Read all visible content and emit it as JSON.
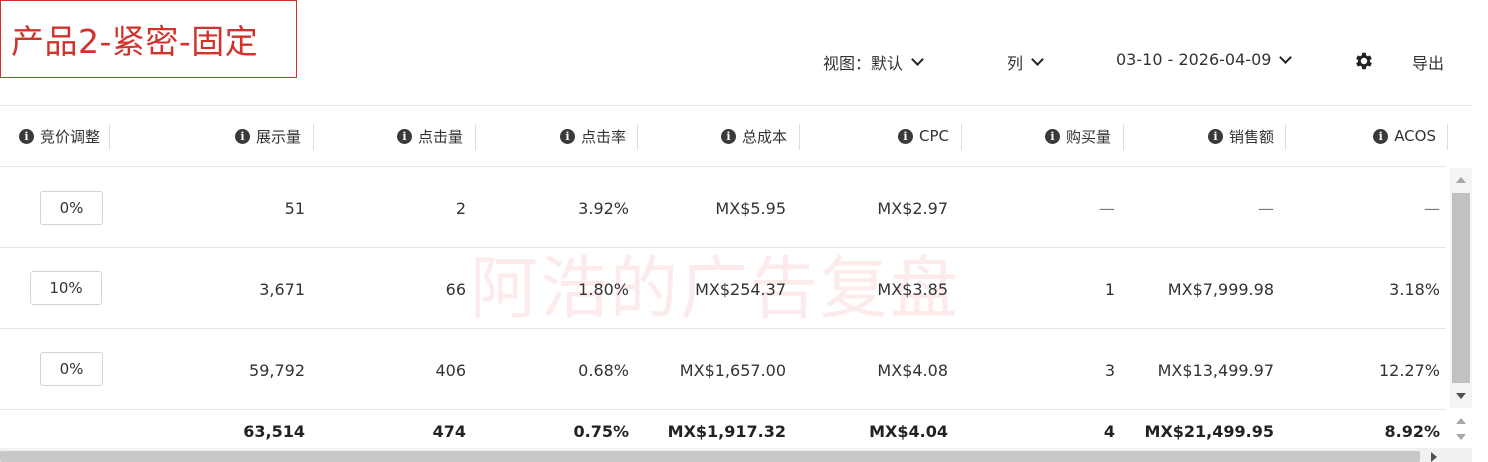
{
  "title": "产品2-紧密-固定",
  "toolbar": {
    "view_label": "视图：默认",
    "columns_label": "列",
    "date_range": "03-10 - 2026-04-09",
    "export_label": "导出"
  },
  "columns": [
    "竞价调整",
    "展示量",
    "点击量",
    "点击率",
    "总成本",
    "CPC",
    "购买量",
    "销售额",
    "ACOS"
  ],
  "rows": [
    {
      "bid_adjust": "0%",
      "impressions": "51",
      "clicks": "2",
      "ctr": "3.92%",
      "cost": "MX$5.95",
      "cpc": "MX$2.97",
      "purchases": "—",
      "sales": "—",
      "acos": "—"
    },
    {
      "bid_adjust": "10%",
      "impressions": "3,671",
      "clicks": "66",
      "ctr": "1.80%",
      "cost": "MX$254.37",
      "cpc": "MX$3.85",
      "purchases": "1",
      "sales": "MX$7,999.98",
      "acos": "3.18%"
    },
    {
      "bid_adjust": "0%",
      "impressions": "59,792",
      "clicks": "406",
      "ctr": "0.68%",
      "cost": "MX$1,657.00",
      "cpc": "MX$4.08",
      "purchases": "3",
      "sales": "MX$13,499.97",
      "acos": "12.27%"
    }
  ],
  "totals": {
    "impressions": "63,514",
    "clicks": "474",
    "ctr": "0.75%",
    "cost": "MX$1,917.32",
    "cpc": "MX$4.04",
    "purchases": "4",
    "sales": "MX$21,499.95",
    "acos": "8.92%"
  },
  "watermark": "阿浩的广告复盘",
  "icons": {
    "info": "info-icon",
    "gear": "gear-icon",
    "chevron": "chevron-down-icon"
  }
}
